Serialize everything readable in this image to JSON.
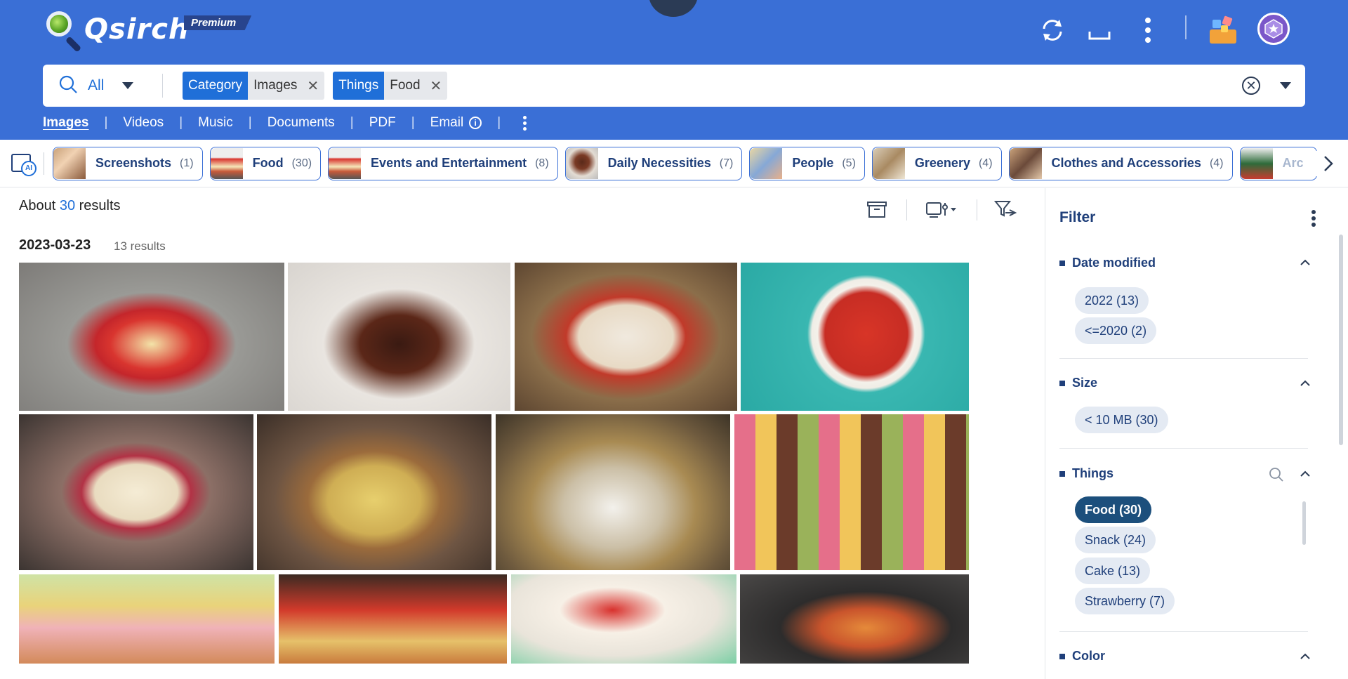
{
  "app": {
    "name": "Qsirch",
    "badge": "Premium"
  },
  "header_icons": [
    "sync-icon",
    "minimize-icon",
    "more-vertical-icon",
    "apps-icon",
    "user-avatar-icon"
  ],
  "search": {
    "scope_label": "All",
    "filters": [
      {
        "key": "Category",
        "value": "Images"
      },
      {
        "key": "Things",
        "value": "Food"
      }
    ]
  },
  "types": {
    "tabs": [
      "Images",
      "Videos",
      "Music",
      "Documents",
      "PDF",
      "Email"
    ],
    "active": "Images"
  },
  "categories": [
    {
      "name": "Screenshots",
      "count": "(1)"
    },
    {
      "name": "Food",
      "count": "(30)"
    },
    {
      "name": "Events and Entertainment",
      "count": "(8)"
    },
    {
      "name": "Daily Necessities",
      "count": "(7)"
    },
    {
      "name": "People",
      "count": "(5)"
    },
    {
      "name": "Greenery",
      "count": "(4)"
    },
    {
      "name": "Clothes and Accessories",
      "count": "(4)"
    },
    {
      "name": "Arc",
      "count": ""
    }
  ],
  "results": {
    "prefix": "About",
    "count": "30",
    "suffix": "results",
    "group_date": "2023-03-23",
    "group_count": "13 results"
  },
  "filter": {
    "title": "Filter",
    "sections": [
      {
        "title": "Date modified",
        "options": [
          "2022 (13)",
          "<=2020 (2)"
        ]
      },
      {
        "title": "Size",
        "options": [
          "< 10 MB (30)"
        ]
      },
      {
        "title": "Things",
        "options": [
          "Food (30)",
          "Snack (24)",
          "Cake (13)",
          "Strawberry (7)"
        ],
        "selected": "Food (30)"
      },
      {
        "title": "Color",
        "options": []
      }
    ]
  },
  "colors": {
    "header_bg": "#3a6fd6",
    "accent": "#1f6fd8",
    "dark_navy": "#1f3f7a",
    "selected_pill": "#1c4f7c"
  }
}
